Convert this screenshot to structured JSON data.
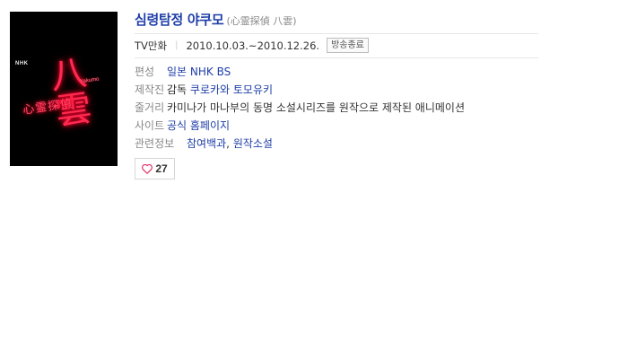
{
  "poster": {
    "broadcaster": "NHK",
    "title_char": "八雲",
    "subtitle": "心霊探偵",
    "small_text": "Yakumo"
  },
  "title": {
    "korean": "심령탐정 야쿠모",
    "original": "(心霊探偵 八雲)"
  },
  "meta": {
    "type": "TV만화",
    "period": "2010.10.03.~2010.12.26.",
    "status": "방송종료"
  },
  "details": {
    "broadcast": {
      "label": "편성",
      "value": "일본 NHK BS"
    },
    "staff": {
      "label": "제작진",
      "prefix": "감독",
      "links": [
        "쿠로카와 토모유키"
      ]
    },
    "synopsis": {
      "label": "줄거리",
      "value": "카미나가 마나부의 동명 소설시리즈를 원작으로 제작된 애니메이션"
    },
    "site": {
      "label": "사이트",
      "value": "공식 홈페이지"
    },
    "related": {
      "label": "관련정보",
      "links": [
        "참여백과",
        "원작소설"
      ]
    }
  },
  "like": {
    "count": "27"
  },
  "colors": {
    "link": "#1f3fa8",
    "label": "#888888",
    "heart": "#e0245e"
  }
}
